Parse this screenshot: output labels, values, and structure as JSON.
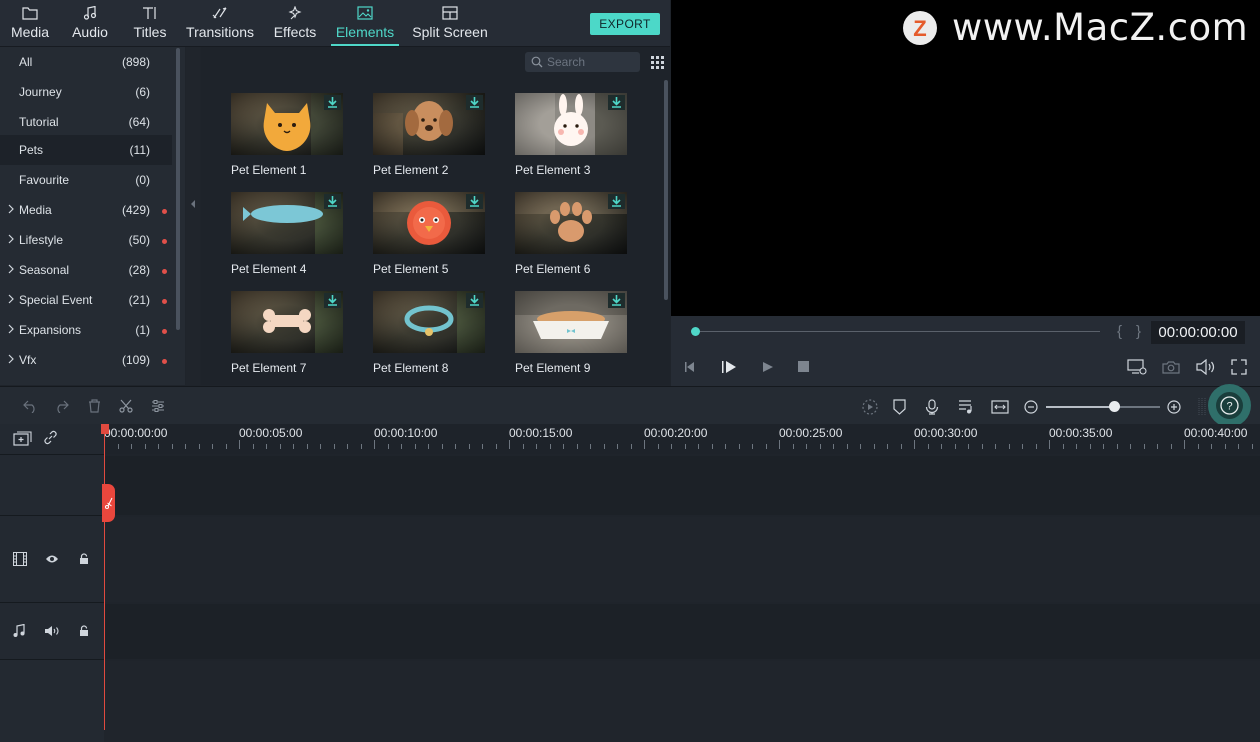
{
  "tabs": [
    {
      "label": "Media",
      "icon": "folder-icon"
    },
    {
      "label": "Audio",
      "icon": "music-note-icon"
    },
    {
      "label": "Titles",
      "icon": "text-t-icon"
    },
    {
      "label": "Transitions",
      "icon": "transition-icon"
    },
    {
      "label": "Effects",
      "icon": "sparkle-icon"
    },
    {
      "label": "Elements",
      "icon": "image-icon"
    },
    {
      "label": "Split Screen",
      "icon": "split-screen-icon"
    }
  ],
  "active_tab": "Elements",
  "export_label": "EXPORT",
  "categories": [
    {
      "name": "All",
      "count": "(898)"
    },
    {
      "name": "Journey",
      "count": "(6)"
    },
    {
      "name": "Tutorial",
      "count": "(64)"
    },
    {
      "name": "Pets",
      "count": "(11)"
    },
    {
      "name": "Favourite",
      "count": "(0)"
    },
    {
      "name": "Media",
      "count": "(429)"
    },
    {
      "name": "Lifestyle",
      "count": "(50)"
    },
    {
      "name": "Seasonal",
      "count": "(28)"
    },
    {
      "name": "Special Event",
      "count": "(21)"
    },
    {
      "name": "Expansions",
      "count": "(1)"
    },
    {
      "name": "Vfx",
      "count": "(109)"
    }
  ],
  "selected_category": "Pets",
  "search": {
    "placeholder": "Search",
    "value": ""
  },
  "elements": [
    {
      "label": "Pet Element 1",
      "art": "cat-face"
    },
    {
      "label": "Pet Element 2",
      "art": "dog-face"
    },
    {
      "label": "Pet Element 3",
      "art": "rabbit-face"
    },
    {
      "label": "Pet Element 4",
      "art": "fish"
    },
    {
      "label": "Pet Element 5",
      "art": "bird"
    },
    {
      "label": "Pet Element 6",
      "art": "paw"
    },
    {
      "label": "Pet Element 7",
      "art": "bone"
    },
    {
      "label": "Pet Element 8",
      "art": "collar"
    },
    {
      "label": "Pet Element 9",
      "art": "pet-bowl"
    }
  ],
  "preview": {
    "watermark_logo_letter": "Z",
    "watermark_text": "www.MacZ.com",
    "timecode": "00:00:00:00",
    "mark_in": "{",
    "mark_out": "}"
  },
  "timeline": {
    "ruler_labels": [
      "00:00:00:00",
      "00:00:05:00",
      "00:00:10:00",
      "00:00:15:00",
      "00:00:20:00",
      "00:00:25:00",
      "00:00:30:00",
      "00:00:35:00",
      "00:00:40:00"
    ],
    "zoom_level": 0.6,
    "help_label": "?"
  },
  "colors": {
    "accent": "#4fd7c8",
    "playhead": "#e04a3f",
    "notification_dot": "#e0504a",
    "background": "#1f242b"
  }
}
